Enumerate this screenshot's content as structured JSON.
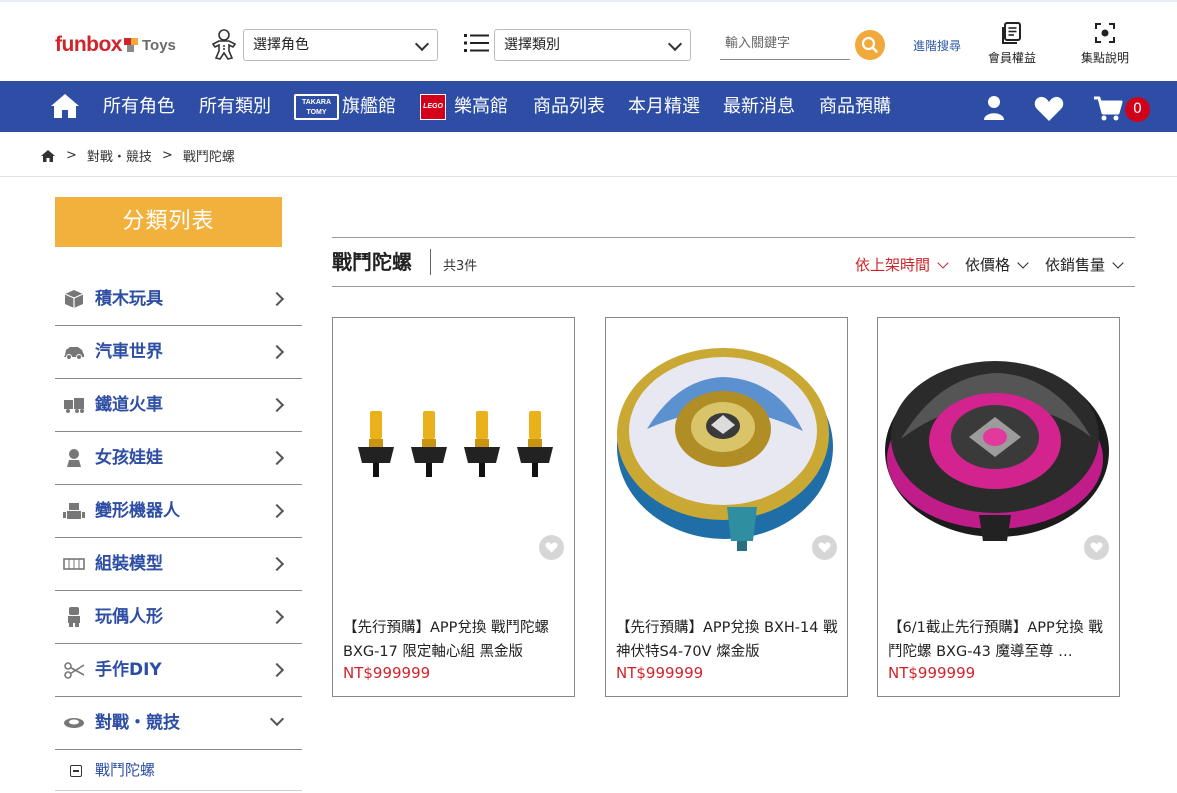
{
  "brand": {
    "logo_main": "funbox",
    "logo_sub": "Toys"
  },
  "header": {
    "character_select": "選擇角色",
    "category_select": "選擇類別",
    "search_placeholder": "輸入關鍵字",
    "advanced_search": "進階搜尋",
    "member_benefits": "會員權益",
    "points_info": "集點說明"
  },
  "nav": {
    "all_characters": "所有角色",
    "all_categories": "所有類別",
    "takara_badge_line1": "TAKARA",
    "takara_badge_line2": "TOMY",
    "flagship": "旗艦館",
    "lego_badge": "LEGO",
    "lego_hall": "樂高館",
    "product_list": "商品列表",
    "monthly_picks": "本月精選",
    "latest_news": "最新消息",
    "preorder": "商品預購",
    "cart_count": "0"
  },
  "breadcrumb": {
    "level1": "對戰・競技",
    "level2": "戰鬥陀螺",
    "separator": ">"
  },
  "sidebar": {
    "title": "分類列表",
    "items": [
      {
        "label": "積木玩具",
        "icon": "blocks-icon"
      },
      {
        "label": "汽車世界",
        "icon": "car-icon"
      },
      {
        "label": "鐵道火車",
        "icon": "train-icon"
      },
      {
        "label": "女孩娃娃",
        "icon": "doll-icon"
      },
      {
        "label": "變形機器人",
        "icon": "robot-icon"
      },
      {
        "label": "組裝模型",
        "icon": "model-kit-icon"
      },
      {
        "label": "玩偶人形",
        "icon": "figure-icon"
      },
      {
        "label": "手作DIY",
        "icon": "scissors-icon"
      },
      {
        "label": "對戰・競技",
        "icon": "spinning-top-icon"
      }
    ],
    "sub_item": "戰鬥陀螺"
  },
  "main": {
    "title": "戰鬥陀螺",
    "count": "共3件",
    "sort_newest": "依上架時間",
    "sort_price": "依價格",
    "sort_sales": "依銷售量"
  },
  "products": [
    {
      "name": "【先行預購】APP兌換 戰鬥陀螺 BXG-17 限定軸心組 黑金版",
      "price": "NT$999999"
    },
    {
      "name": "【先行預購】APP兌換 BXH-14 戰神伏特S4-70V 燦金版",
      "price": "NT$999999"
    },
    {
      "name": "【6/1截止先行預購】APP兌換 戰鬥陀螺 BXG-43 魔導至尊 …",
      "price": "NT$999999"
    }
  ],
  "colors": {
    "nav_blue": "#2d4ea4",
    "accent_orange": "#f2b13c",
    "price_red": "#d0242a",
    "badge_red": "#d0021b"
  }
}
